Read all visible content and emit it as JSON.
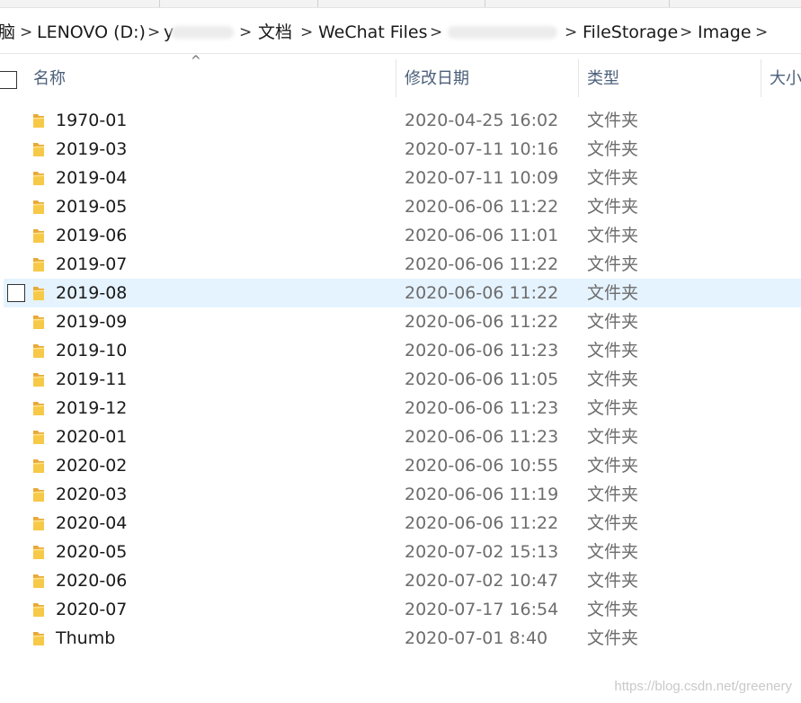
{
  "breadcrumb": {
    "computer_tail": "脑",
    "drive": "LENOVO (D:)",
    "user_fragment": "y",
    "documents": "文档",
    "wechat_files": "WeChat Files",
    "account_fragment": "",
    "filestorage": "FileStorage",
    "image": "Image",
    "separator": ">"
  },
  "columns": {
    "name": "名称",
    "date_modified": "修改日期",
    "type": "类型",
    "size": "大小",
    "sort_indicator": "^"
  },
  "rows": [
    {
      "name": "1970-01",
      "date": "2020-04-25 16:02",
      "type": "文件夹"
    },
    {
      "name": "2019-03",
      "date": "2020-07-11 10:16",
      "type": "文件夹"
    },
    {
      "name": "2019-04",
      "date": "2020-07-11 10:09",
      "type": "文件夹"
    },
    {
      "name": "2019-05",
      "date": "2020-06-06 11:22",
      "type": "文件夹"
    },
    {
      "name": "2019-06",
      "date": "2020-06-06 11:01",
      "type": "文件夹"
    },
    {
      "name": "2019-07",
      "date": "2020-06-06 11:22",
      "type": "文件夹"
    },
    {
      "name": "2019-08",
      "date": "2020-06-06 11:22",
      "type": "文件夹",
      "selected": true
    },
    {
      "name": "2019-09",
      "date": "2020-06-06 11:22",
      "type": "文件夹"
    },
    {
      "name": "2019-10",
      "date": "2020-06-06 11:23",
      "type": "文件夹"
    },
    {
      "name": "2019-11",
      "date": "2020-06-06 11:05",
      "type": "文件夹"
    },
    {
      "name": "2019-12",
      "date": "2020-06-06 11:23",
      "type": "文件夹"
    },
    {
      "name": "2020-01",
      "date": "2020-06-06 11:23",
      "type": "文件夹"
    },
    {
      "name": "2020-02",
      "date": "2020-06-06 10:55",
      "type": "文件夹"
    },
    {
      "name": "2020-03",
      "date": "2020-06-06 11:19",
      "type": "文件夹"
    },
    {
      "name": "2020-04",
      "date": "2020-06-06 11:22",
      "type": "文件夹"
    },
    {
      "name": "2020-05",
      "date": "2020-07-02 15:13",
      "type": "文件夹"
    },
    {
      "name": "2020-06",
      "date": "2020-07-02 10:47",
      "type": "文件夹"
    },
    {
      "name": "2020-07",
      "date": "2020-07-17 16:54",
      "type": "文件夹"
    },
    {
      "name": "Thumb",
      "date": "2020-07-01 8:40",
      "type": "文件夹"
    }
  ],
  "icons": {
    "folder": "folder-icon",
    "separator": "chevron-right-icon",
    "checkbox": "checkbox-icon"
  },
  "colors": {
    "selected_row": "#e5f3ff",
    "header_text": "#4c607a",
    "folder_yellow": "#f7c948",
    "secondary_text": "#6d6d6d"
  },
  "watermark": "https://blog.csdn.net/greenery"
}
